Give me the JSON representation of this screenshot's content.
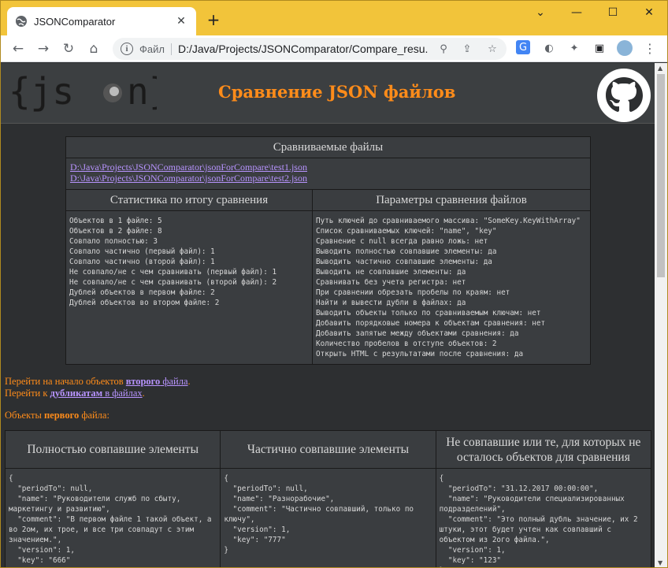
{
  "browser": {
    "tab_title": "JSONComparator",
    "scheme_label": "Файл",
    "url": "D:/Java/Projects/JSONComparator/Compare_resu...",
    "colors": {
      "titlebar": "#f2c43a",
      "accent": "#ff8c1a",
      "link": "#b894ff"
    }
  },
  "page": {
    "logo_text": "{json}",
    "title": "Сравнение JSON файлов",
    "files_header": "Сравниваемые файлы",
    "files": [
      "D:\\Java\\Projects\\JSONComparator\\jsonForCompare\\test1.json",
      "D:\\Java\\Projects\\JSONComparator\\jsonForCompare\\test2.json"
    ],
    "stats_header": "Статистика по итогу сравнения",
    "params_header": "Параметры сравнения файлов",
    "stats": [
      "Объектов в 1 файле: 5",
      "Объектов в 2 файле: 8",
      "Совпало полностью: 3",
      "Совпало частично (первый файл): 1",
      "Совпало частично (второй файл): 1",
      "Не совпало/не с чем сравнивать (первый файл): 1",
      "Не совпало/не с чем сравнивать (второй файл): 2",
      "Дублей объектов в первом файле: 2",
      "Дублей объектов во втором файле: 2"
    ],
    "params": [
      "Путь ключей до сравниваемого массива: \"SomeKey.KeyWithArray\"",
      "Список сравниваемых ключей: \"name\", \"key\"",
      "Сравнение с null всегда равно ложь: нет",
      "Выводить полностью совпавшие элементы: да",
      "Выводить частично совпавшие элементы: да",
      "Выводить не совпавшие элементы: да",
      "Сравнивать без учета регистра: нет",
      "При сравнении обрезать пробелы по краям: нет",
      "Найти и вывести дубли в файлах: да",
      "Выводить объекты только по сравниваемым ключам: нет",
      "Добавить порядковые номера к объектам сравнения: нет",
      "Добавить запятые между объектами сравнения: да",
      "Количество пробелов в отступе объектов: 2",
      "Открыть HTML с результатами после сравнения: да"
    ],
    "nav_links": {
      "line1_prefix": "Перейти на начало объектов ",
      "line1_bold": "второго",
      "line1_link": " файла",
      "line1_suffix": ".",
      "line2_prefix": "Перейти к ",
      "line2_bold": "дубликатам",
      "line2_link": " в файлах",
      "line2_suffix": "."
    },
    "objects_title": {
      "prefix": "Объекты ",
      "bold": "первого",
      "suffix": " файла:"
    },
    "compare_headers": [
      "Полностью совпавшие элементы",
      "Частично совпавшие элементы",
      "Не совпавшие или те, для которых не осталось объектов для сравнения"
    ],
    "compare_cells": [
      "{\n  \"periodTo\": null,\n  \"name\": \"Руководители служб по сбыту, маркетингу и развитию\",\n  \"comment\": \"В первом файле 1 такой объект, а во 2ом, их трое, и все три совпадут с этим значением.\",\n  \"version\": 1,\n  \"key\": \"666\"",
      "{\n  \"periodTo\": null,\n  \"name\": \"Разнорабочие\",\n  \"comment\": \"Частично совпавший, только по ключу\",\n  \"version\": 1,\n  \"key\": \"777\"\n}",
      "{\n  \"periodTo\": \"31.12.2017 00:00:00\",\n  \"name\": \"Руководители специализированных подразделений\",\n  \"comment\": \"Это полный дубль значение, их 2 штуки, этот будет учтен как совпавший с объектом из 2ого файла.\",\n  \"version\": 1,\n  \"key\": \"123\"\n}"
    ]
  }
}
